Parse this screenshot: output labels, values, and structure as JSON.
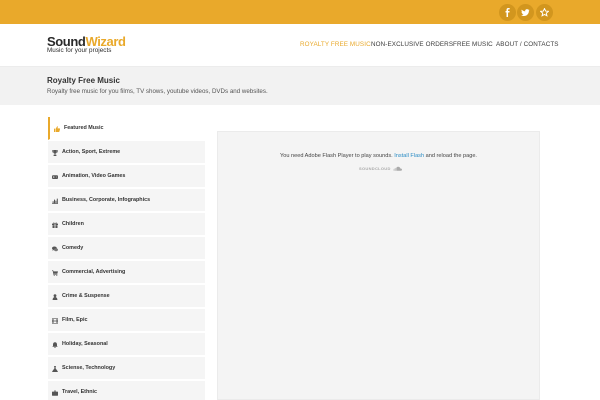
{
  "topbar": {
    "color": "#e9a92b",
    "social": [
      {
        "icon": "facebook-icon",
        "glyph": "f"
      },
      {
        "icon": "twitter-icon",
        "glyph": "t"
      },
      {
        "icon": "star-icon",
        "glyph": "★"
      }
    ]
  },
  "header": {
    "logo": {
      "part1": "Sound",
      "part2": "Wizard",
      "tagline": "Music for your projects"
    },
    "nav": [
      {
        "label": "ROYALTY FREE MUSIC",
        "active": true
      },
      {
        "label": "NON-EXCLUSIVE ORDERS",
        "active": false
      },
      {
        "label": "FREE MUSIC",
        "active": false
      },
      {
        "label": "ABOUT / CONTACTS",
        "active": false
      }
    ]
  },
  "band": {
    "title": "Royalty Free Music",
    "subtitle": "Royalty free music for you films, TV shows, youtube videos, DVDs and websites."
  },
  "sidebar": {
    "items": [
      {
        "label": "Featured Music",
        "icon": "thumbs-up-icon",
        "active": true
      },
      {
        "label": "Action, Sport, Extreme",
        "icon": "trophy-icon",
        "active": false
      },
      {
        "label": "Animation, Video Games",
        "icon": "gamepad-icon",
        "active": false
      },
      {
        "label": "Business, Corporate, Infographics",
        "icon": "chart-icon",
        "active": false
      },
      {
        "label": "Children",
        "icon": "gift-icon",
        "active": false
      },
      {
        "label": "Comedy",
        "icon": "comments-icon",
        "active": false
      },
      {
        "label": "Commercial, Advertising",
        "icon": "cart-icon",
        "active": false
      },
      {
        "label": "Crime & Suspense",
        "icon": "user-icon",
        "active": false
      },
      {
        "label": "Film, Epic",
        "icon": "film-icon",
        "active": false
      },
      {
        "label": "Holiday, Seasonal",
        "icon": "bell-icon",
        "active": false
      },
      {
        "label": "Sciense, Technology",
        "icon": "flask-icon",
        "active": false
      },
      {
        "label": "Travel, Ethnic",
        "icon": "suitcase-icon",
        "active": false
      }
    ]
  },
  "player": {
    "message_before": "You need Adobe Flash Player to play sounds.",
    "link": "Install Flash",
    "message_after": "and reload the page.",
    "brand": "SOUNDCLOUD"
  }
}
